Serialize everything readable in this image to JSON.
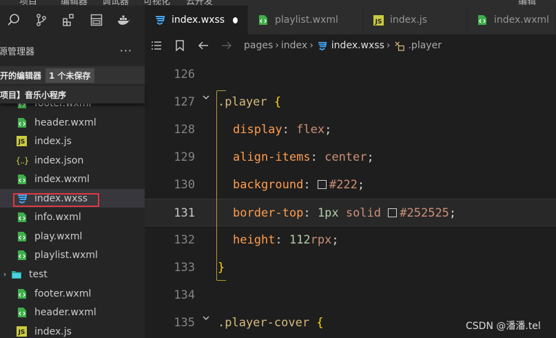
{
  "menubar": {
    "items": [
      "项目",
      "编辑器",
      "调试器",
      "可视化",
      "云开发"
    ],
    "right": "编辑"
  },
  "sidebar": {
    "activity_icons": [
      "search-icon",
      "source-control-icon",
      "extensions-icon",
      "layout-icon",
      "docker-icon"
    ],
    "explorer_title": "源管理器",
    "more": "···",
    "open_editors_label": "开的编辑器",
    "unsaved_badge": "1 个未保存",
    "project_label": "项目】音乐小程序",
    "files": [
      {
        "name": "footer.wxml",
        "type": "wxml"
      },
      {
        "name": "header.wxml",
        "type": "wxml"
      },
      {
        "name": "index.js",
        "type": "js"
      },
      {
        "name": "index.json",
        "type": "json"
      },
      {
        "name": "index.wxml",
        "type": "wxml"
      },
      {
        "name": "index.wxss",
        "type": "wxss"
      },
      {
        "name": "info.wxml",
        "type": "wxml"
      },
      {
        "name": "play.wxml",
        "type": "wxml"
      },
      {
        "name": "playlist.wxml",
        "type": "wxml"
      },
      {
        "name": "test",
        "type": "folder"
      },
      {
        "name": "footer.wxml",
        "type": "wxml"
      },
      {
        "name": "header.wxml",
        "type": "wxml"
      },
      {
        "name": "index.js",
        "type": "js"
      }
    ],
    "js_badge": "JS",
    "json_badge": "{..}"
  },
  "tabs": [
    {
      "label": "index.wxss",
      "type": "wxss",
      "active": true,
      "modified": true
    },
    {
      "label": "playlist.wxml",
      "type": "wxml",
      "active": false
    },
    {
      "label": "index.js",
      "type": "js",
      "active": false
    },
    {
      "label": "index.wxml",
      "type": "wxml",
      "active": false
    }
  ],
  "breadcrumb": {
    "items": [
      "pages",
      "index",
      "index.wxss",
      ".player"
    ],
    "sep": "›"
  },
  "editor": {
    "lines": [
      {
        "num": "126"
      },
      {
        "num": "127",
        "selector": ".player",
        "brace": "{"
      },
      {
        "num": "128",
        "prop": "display",
        "value": "flex"
      },
      {
        "num": "129",
        "prop": "align-items",
        "value": "center"
      },
      {
        "num": "130",
        "prop": "background",
        "hex": "#222",
        "swatch": "#222222"
      },
      {
        "num": "131",
        "prop": "border-top",
        "num_value": "1px",
        "value": "solid",
        "hex": "#252525",
        "swatch": "#252525",
        "current": true
      },
      {
        "num": "132",
        "prop": "height",
        "num_value": "112",
        "unit": "rpx"
      },
      {
        "num": "133",
        "brace": "}"
      },
      {
        "num": "134"
      },
      {
        "num": "135",
        "selector": ".player-cover",
        "brace": "{"
      }
    ],
    "colon": ":",
    "semicolon": ";"
  },
  "watermark": "CSDN @潘潘.tel"
}
